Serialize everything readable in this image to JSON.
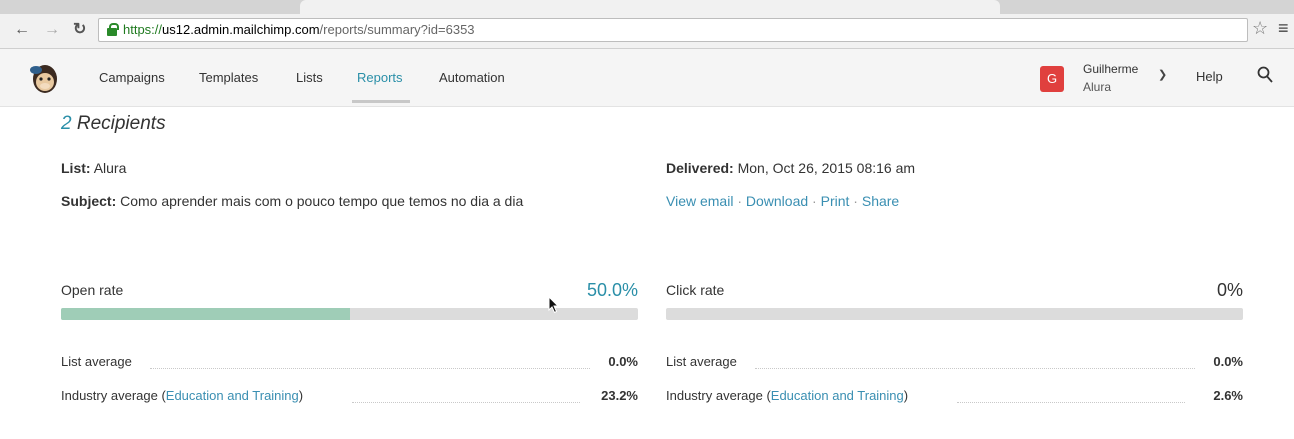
{
  "browser": {
    "url_scheme": "https://",
    "url_host": "us12.admin.mailchimp.com",
    "url_path": "/reports/summary?id=6353",
    "back_icon": "arrow-left",
    "forward_icon": "arrow-right",
    "reload_icon": "reload"
  },
  "nav": {
    "items": [
      "Campaigns",
      "Templates",
      "Lists",
      "Reports",
      "Automation"
    ],
    "active": "Reports",
    "user_initial": "G",
    "user_name": "Guilherme",
    "org_name": "Alura",
    "help": "Help",
    "accent_color": "#2a8fa8",
    "avatar_color": "#e0403e"
  },
  "report": {
    "recipients_count": "2",
    "recipients_label": "Recipients",
    "list_label": "List:",
    "list_value": "Alura",
    "subject_label": "Subject:",
    "subject_value": "Como aprender mais com o pouco tempo que temos no dia a dia",
    "delivered_label": "Delivered:",
    "delivered_value": "Mon, Oct 26, 2015 08:16 am",
    "actions": [
      "View email",
      "Download",
      "Print",
      "Share"
    ]
  },
  "stats": {
    "open": {
      "label": "Open rate",
      "value": "50.0%",
      "fraction": 0.5,
      "list_avg_label": "List average",
      "list_avg_value": "0.0%",
      "industry_prefix": "Industry average (",
      "industry_link": "Education and Training",
      "industry_suffix": ")",
      "industry_value": "23.2%"
    },
    "click": {
      "label": "Click rate",
      "value": "0%",
      "fraction": 0,
      "list_avg_label": "List average",
      "list_avg_value": "0.0%",
      "industry_prefix": "Industry average (",
      "industry_link": "Education and Training",
      "industry_suffix": ")",
      "industry_value": "2.6%"
    }
  }
}
